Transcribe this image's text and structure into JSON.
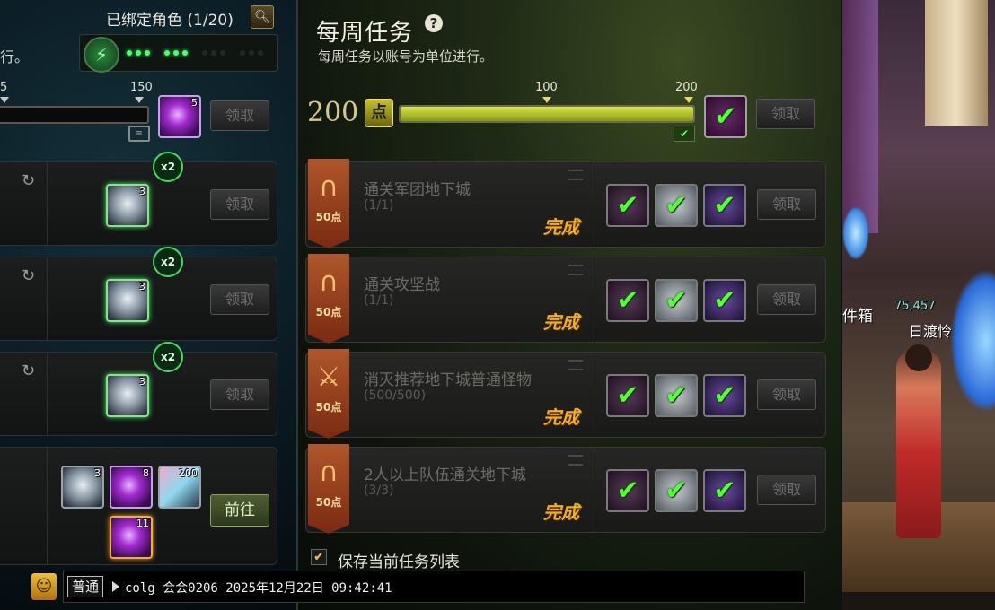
{
  "left_panel": {
    "bound_title": "已绑定角色 (1/20)",
    "search_icon": "magnifier-icon",
    "desc_fragment": "行。",
    "energy_dots_on": 6,
    "energy_dots_total": 12,
    "scale_start": "5",
    "scale_end": "150",
    "reward_count": "5",
    "claim_label": "领取",
    "rows": [
      {
        "badge": "x2",
        "item_count": "3",
        "claim_label": "领取"
      },
      {
        "badge": "x2",
        "item_count": "3",
        "claim_label": "领取"
      },
      {
        "badge": "x2",
        "item_count": "3",
        "claim_label": "领取"
      }
    ],
    "bottom_row": {
      "items": [
        {
          "type": "silver",
          "count": "3"
        },
        {
          "type": "orb",
          "count": "8"
        },
        {
          "type": "ticket",
          "count": "200"
        },
        {
          "type": "orb-gold",
          "count": "11"
        }
      ],
      "go_label": "前往"
    }
  },
  "weekly": {
    "title": "每周任务",
    "help": "?",
    "subtitle": "每周任务以账号为单位进行。",
    "points": "200",
    "points_icon": "点",
    "progress_fraction": 1.0,
    "scale_100": "100",
    "scale_200": "200",
    "claim_label": "领取",
    "tasks": [
      {
        "name": "通关军团地下城",
        "progress": "(1/1)",
        "points": "50点",
        "status": "完成",
        "claim_label": "领取"
      },
      {
        "name": "通关攻坚战",
        "progress": "(1/1)",
        "points": "50点",
        "status": "完成",
        "claim_label": "领取"
      },
      {
        "name": "消灭推荐地下城普通怪物",
        "progress": "(500/500)",
        "points": "50点",
        "status": "完成",
        "claim_label": "领取"
      },
      {
        "name": "2人以上队伍通关地下城",
        "progress": "(3/3)",
        "points": "50点",
        "status": "完成",
        "claim_label": "领取"
      }
    ],
    "save_label": "保存当前任务列表"
  },
  "scene": {
    "left_label": "件箱",
    "gold": "75,457",
    "char_name": "日渡怜"
  },
  "chat": {
    "channel": "普通",
    "message": "colg 会会0206 2025年12月22日 09:42:41"
  },
  "colors": {
    "accent_green": "#55ff3a",
    "done_gold": "#f0b020",
    "banner": "#b0562a"
  }
}
